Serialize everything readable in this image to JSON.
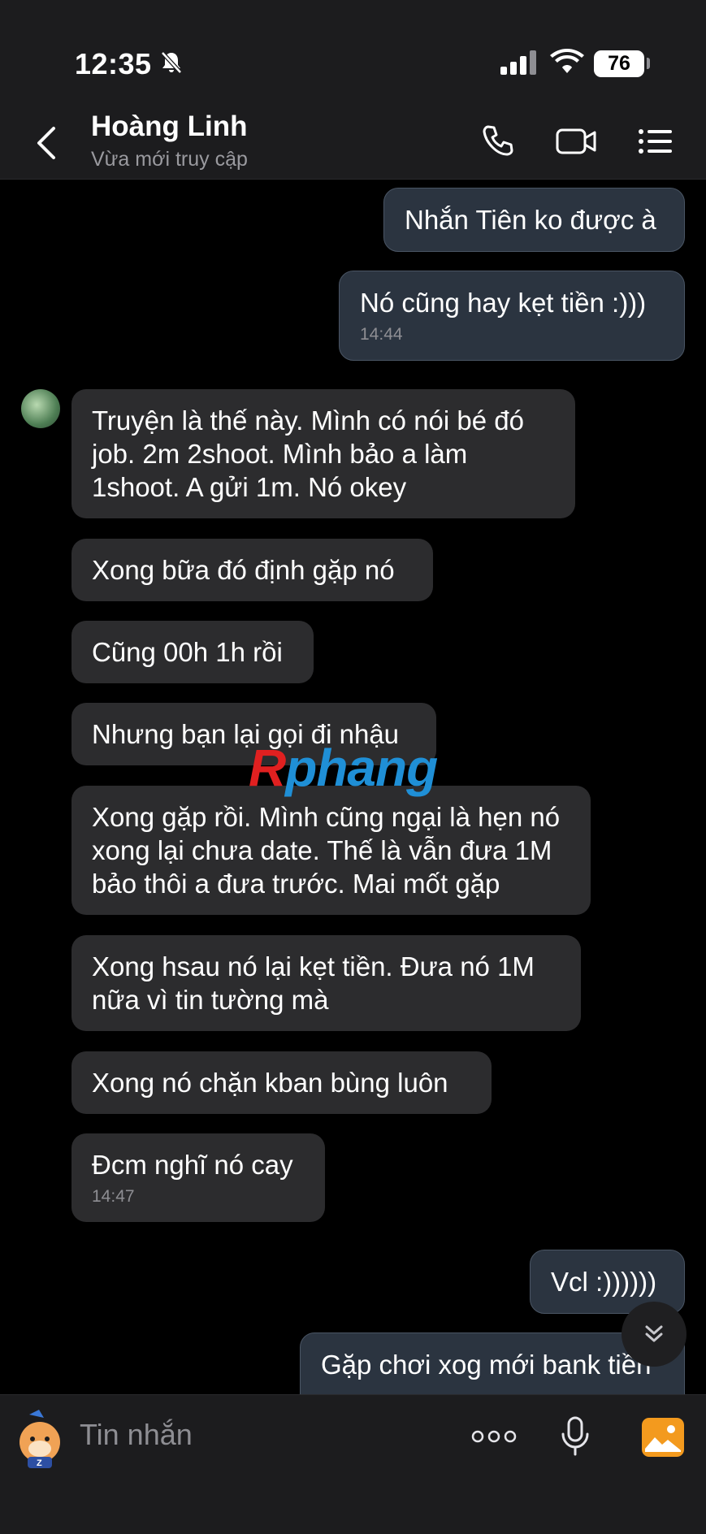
{
  "status_bar": {
    "time": "12:35",
    "battery": "76"
  },
  "header": {
    "name": "Hoàng Linh",
    "status": "Vừa mới truy cập"
  },
  "messages": [
    {
      "dir": "out",
      "text": "Nhắn Tiên ko được à"
    },
    {
      "dir": "out",
      "text": "Nó cũng hay kẹt tiền :)))",
      "time": "14:44"
    },
    {
      "dir": "in",
      "text": "Truyện là thế này. Mình có nói bé đó job. 2m 2shoot. Mình bảo a làm 1shoot. A gửi 1m. Nó okey"
    },
    {
      "dir": "in",
      "text": "Xong bữa đó định gặp nó"
    },
    {
      "dir": "in",
      "text": "Cũng 00h 1h rồi"
    },
    {
      "dir": "in",
      "text": "Nhưng bạn lại gọi đi nhậu"
    },
    {
      "dir": "in",
      "text": "Xong gặp rồi. Mình cũng ngại là hẹn nó xong lại chưa date. Thế là vẫn đưa 1M bảo thôi a đưa trước. Mai mốt gặp"
    },
    {
      "dir": "in",
      "text": "Xong hsau nó lại kẹt tiền. Đưa nó 1M nữa vì tin tường mà"
    },
    {
      "dir": "in",
      "text": "Xong nó chặn kban bùng luôn"
    },
    {
      "dir": "in",
      "text": "Đcm nghĩ nó cay",
      "time": "14:47"
    },
    {
      "dir": "out",
      "text": "Vcl :))))))"
    },
    {
      "dir": "out",
      "text": "Gặp chơi xog mới bank tiền"
    }
  ],
  "watermark": {
    "first": "R",
    "rest": "phang"
  },
  "composer": {
    "placeholder": "Tin nhắn"
  },
  "colors": {
    "outgoing_bubble": "#2b3440",
    "incoming_bubble": "#2c2c2e",
    "bar_bg": "#1c1c1e",
    "accent_photo": "#f39a1e"
  },
  "icons": [
    "bell-slash-icon",
    "signal-icon",
    "wifi-icon",
    "back-chevron-icon",
    "phone-icon",
    "video-icon",
    "menu-icon",
    "chevron-double-down-icon",
    "sticker-icon",
    "more-dots-icon",
    "mic-icon",
    "image-icon"
  ]
}
